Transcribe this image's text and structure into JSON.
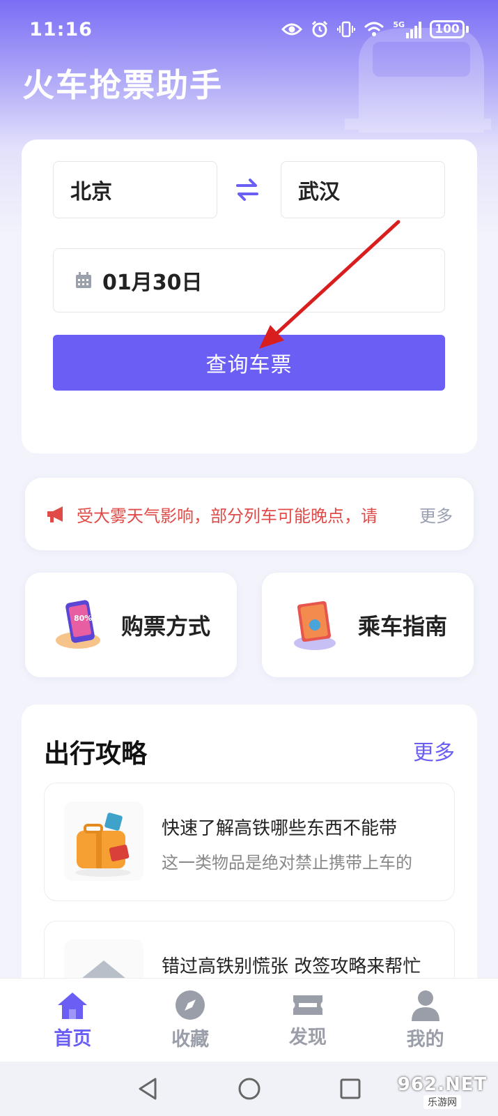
{
  "status_bar": {
    "time": "11:16",
    "network": "5G",
    "battery": "100"
  },
  "app": {
    "title": "火车抢票助手"
  },
  "search": {
    "from_city": "北京",
    "to_city": "武汉",
    "date": "01月30日",
    "query_label": "查询车票"
  },
  "notice": {
    "text": "受大雾天气影响，部分列车可能晚点，请",
    "more": "更多"
  },
  "features": [
    {
      "label": "购票方式",
      "icon": "phone-ticket-icon"
    },
    {
      "label": "乘车指南",
      "icon": "travel-guide-book-icon"
    }
  ],
  "guides": {
    "title": "出行攻略",
    "more": "更多",
    "articles": [
      {
        "title": "快速了解高铁哪些东西不能带",
        "subtitle": "这一类物品是绝对禁止携带上车的"
      },
      {
        "title": "错过高铁别慌张 改签攻略来帮忙",
        "subtitle": ""
      }
    ]
  },
  "bottom_nav": [
    {
      "label": "首页",
      "icon": "home-icon",
      "active": true
    },
    {
      "label": "收藏",
      "icon": "compass-icon",
      "active": false
    },
    {
      "label": "发现",
      "icon": "ticket-icon",
      "active": false
    },
    {
      "label": "我的",
      "icon": "person-icon",
      "active": false
    }
  ],
  "watermark": {
    "top": "962.NET",
    "bottom": "乐游网"
  },
  "colors": {
    "accent": "#6b5ef5",
    "notice": "#e04a47",
    "annotation_arrow": "#d81e1e"
  }
}
